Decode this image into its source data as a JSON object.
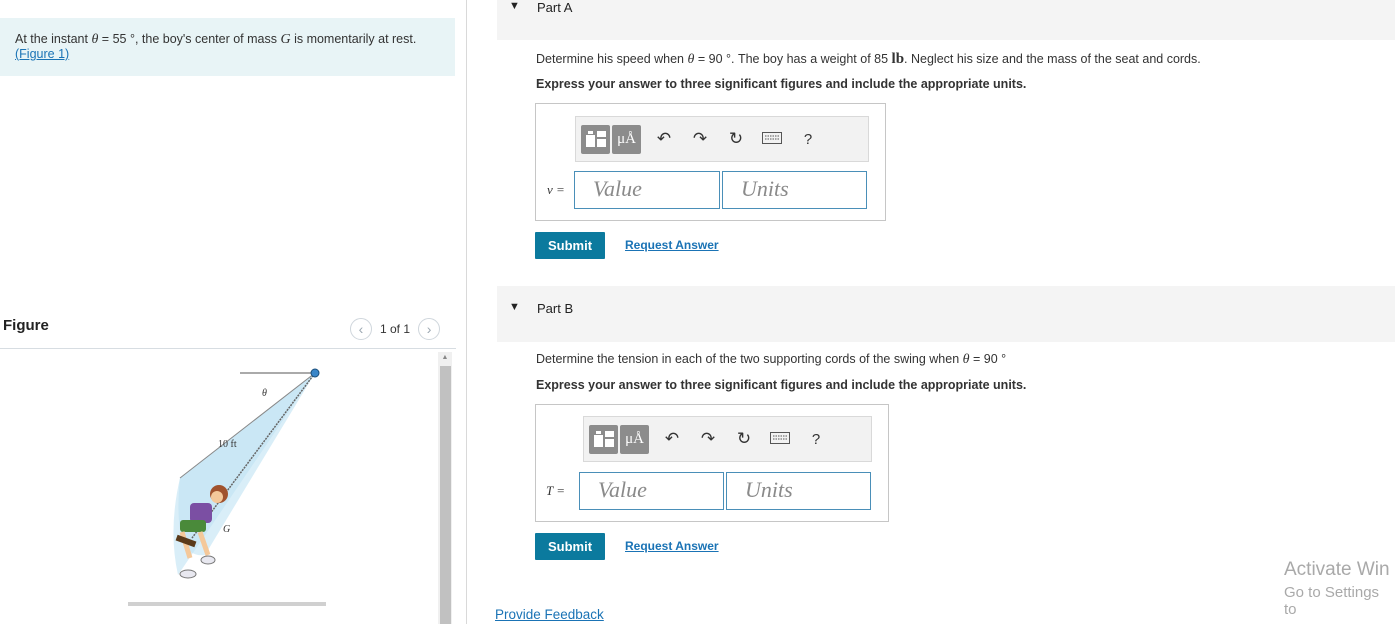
{
  "problem": {
    "text_before": "At the instant ",
    "theta_sym": "θ",
    "eq_value": " = 55 °",
    "text_mid": ", the boy's center of mass ",
    "mass_sym": "G",
    "text_after": " is momentarily at rest.",
    "figure_link": "(Figure 1)"
  },
  "figure": {
    "title": "Figure",
    "pager": "1 of 1",
    "prev_icon": "chevron-left-icon",
    "next_icon": "chevron-right-icon",
    "labels": {
      "theta": "θ",
      "length": "10 ft",
      "center": "G"
    }
  },
  "partA": {
    "label": "Part A",
    "question_pre": "Determine his speed when ",
    "theta_sym": "θ",
    "question_eq": " = 90 °",
    "question_mid": ". The boy has a weight of 85 ",
    "unit_lb": "lb",
    "question_post": ". Neglect his size and the mass of the seat and cords.",
    "instruction": "Express your answer to three significant figures and include the appropriate units.",
    "var_label": "v =",
    "value_placeholder": "Value",
    "units_placeholder": "Units",
    "submit": "Submit",
    "request": "Request Answer"
  },
  "partB": {
    "label": "Part B",
    "question_pre": "Determine the tension in each of the two supporting cords of the swing when ",
    "theta_sym": "θ",
    "question_eq": " = 90 °",
    "instruction": "Express your answer to three significant figures and include the appropriate units.",
    "var_label": "T =",
    "value_placeholder": "Value",
    "units_placeholder": "Units",
    "submit": "Submit",
    "request": "Request Answer"
  },
  "toolbar": {
    "units_btn": "μÅ",
    "help": "?"
  },
  "feedback": "Provide Feedback",
  "watermark": {
    "line1": "Activate Win",
    "line2": "Go to Settings to"
  }
}
